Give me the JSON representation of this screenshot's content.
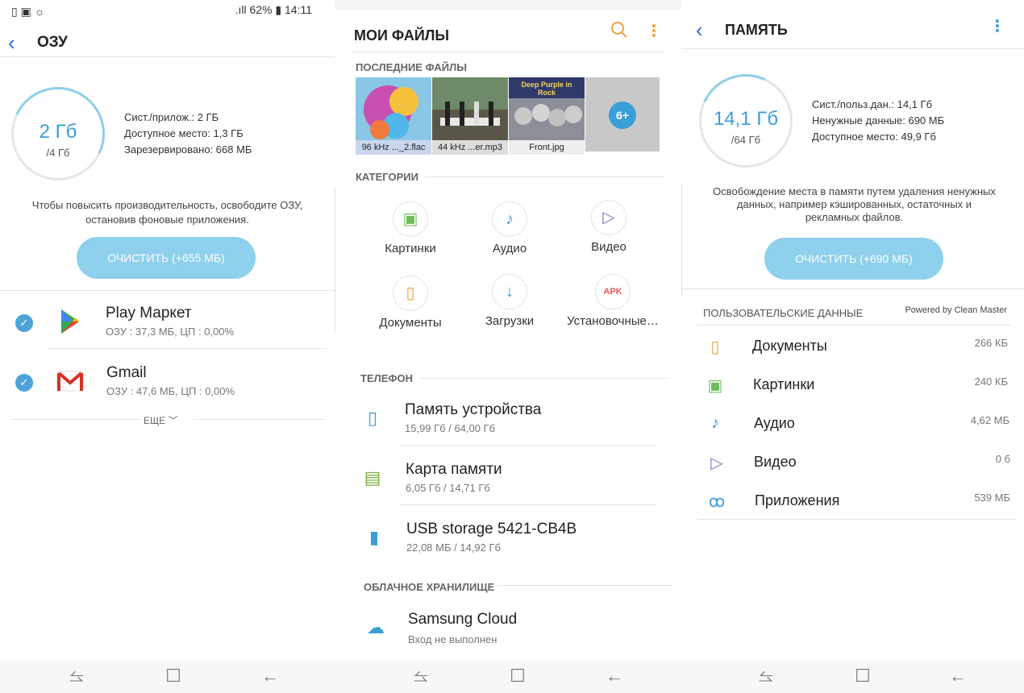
{
  "ram": {
    "status_icons": "▯ ▣ ☼",
    "status_right": ".ıll 62% ▮ 14:11",
    "title": "ОЗУ",
    "used": "2 Гб",
    "total": "/4 Гб",
    "info": [
      "Сист./прилож.: 2 ГБ",
      "Доступное место: 1,3 ГБ",
      "Зарезервировано: 668 МБ"
    ],
    "hint": [
      "Чтобы повысить производительность, освободите ОЗУ,",
      "остановив фоновые приложения."
    ],
    "clean_label": "ОЧИСТИТЬ (+655 МБ)",
    "apps": [
      {
        "name": "Play Маркет",
        "sub": "ОЗУ : 37,3 МБ, ЦП : 0,00%"
      },
      {
        "name": "Gmail",
        "sub": "ОЗУ : 47,6 МБ, ЦП : 0,00%"
      }
    ],
    "more_label": "ЕЩЕ"
  },
  "files": {
    "title": "МОИ ФАЙЛЫ",
    "recent_label": "ПОСЛЕДНИЕ ФАЙЛЫ",
    "recent": [
      {
        "caption": "96 kHz ..._2.flac",
        "color": "#8ac6e6"
      },
      {
        "caption": "44 kHz ...er.mp3",
        "color": "#4b4a3a"
      },
      {
        "caption": "Front.jpg",
        "color": "#2f3a6a"
      }
    ],
    "album_text": "Deep Purple in Rock",
    "more_count": "6+",
    "categories_label": "КАТЕГОРИИ",
    "categories": [
      {
        "label": "Картинки",
        "icon": "▣",
        "color": "#6bbf59"
      },
      {
        "label": "Аудио",
        "icon": "♪",
        "color": "#3a9ed8"
      },
      {
        "label": "Видео",
        "icon": "▷",
        "color": "#8c6fc9"
      },
      {
        "label": "Документы",
        "icon": "▯",
        "color": "#f0a040"
      },
      {
        "label": "Загрузки",
        "icon": "↓",
        "color": "#3a9ed8"
      },
      {
        "label": "Установочные…",
        "icon": "APK",
        "color": "#e05a5a"
      }
    ],
    "phone_label": "ТЕЛЕФОН",
    "storage": [
      {
        "name": "Память устройства",
        "sub": "15,99 Гб / 64,00 Гб",
        "icon": "▯",
        "color": "#3a9ed8"
      },
      {
        "name": "Карта памяти",
        "sub": "6,05 Гб / 14,71 Гб",
        "icon": "▤",
        "color": "#7aab3a"
      },
      {
        "name": "USB storage 5421-CB4B",
        "sub": "22,08 МБ / 14,92 Гб",
        "icon": "▮",
        "color": "#3a9ed8"
      }
    ],
    "cloud_label": "ОБЛАЧНОЕ ХРАНИЛИЩЕ",
    "cloud": {
      "name": "Samsung Cloud",
      "sub": "Вход не выполнен",
      "icon": "☁"
    }
  },
  "memory": {
    "title": "ПАМЯТЬ",
    "used": "14,1 Гб",
    "total": "/64 Гб",
    "info": [
      "Сист./польз.дан.: 14,1 Гб",
      "Ненужные данные: 690 МБ",
      "Доступное место: 49,9 Гб"
    ],
    "hint": [
      "Освобождение места в памяти путем удаления ненужных",
      "данных, например кэшированных, остаточных и",
      "рекламных файлов."
    ],
    "clean_label": "ОЧИСТИТЬ (+690 МБ)",
    "user_data_label": "ПОЛЬЗОВАТЕЛЬСКИЕ ДАННЫЕ",
    "powered": "Powered by Clean Master",
    "rows": [
      {
        "name": "Документы",
        "size": "266 КБ",
        "icon": "▯",
        "color": "#f0a040"
      },
      {
        "name": "Картинки",
        "size": "240 КБ",
        "icon": "▣",
        "color": "#6bbf59"
      },
      {
        "name": "Аудио",
        "size": "4,62 МБ",
        "icon": "♪",
        "color": "#3a9ed8"
      },
      {
        "name": "Видео",
        "size": "0 б",
        "icon": "▷",
        "color": "#8c6fc9"
      },
      {
        "name": "Приложения",
        "size": "539 МБ",
        "icon": "ꝏ",
        "color": "#3a9ed8"
      }
    ]
  },
  "nav": {
    "recent": "⥦",
    "home": "☐",
    "back": "←"
  }
}
